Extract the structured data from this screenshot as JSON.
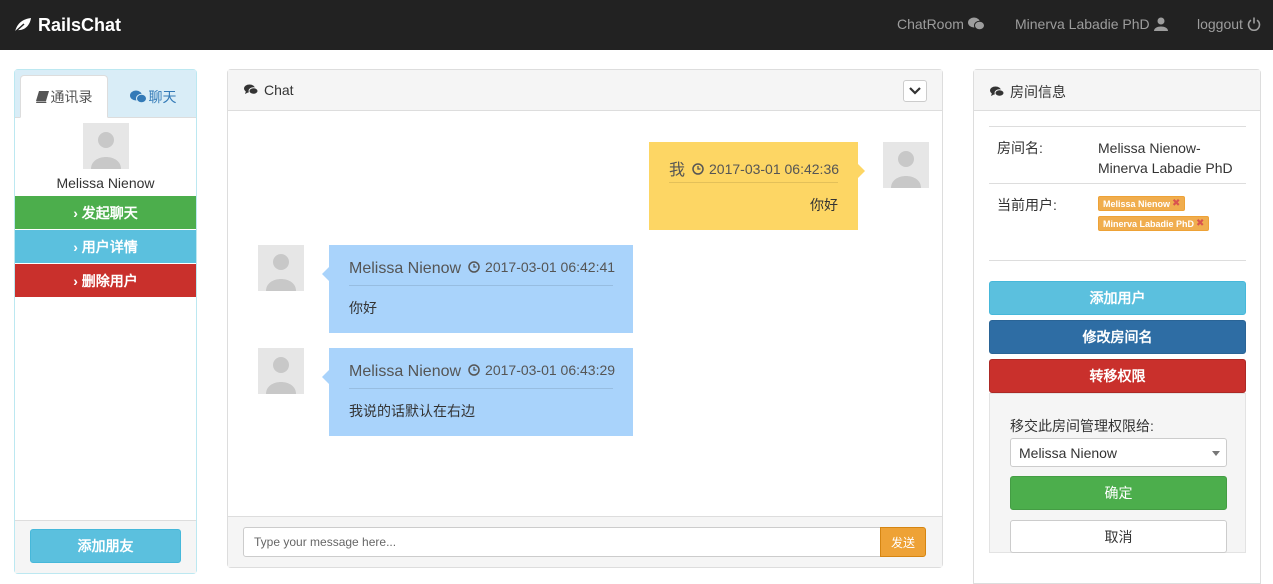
{
  "navbar": {
    "brand": "RailsChat",
    "chatroom": "ChatRoom",
    "user": "Minerva Labadie PhD",
    "logout": "loggout"
  },
  "sidebar": {
    "tabs": [
      {
        "label": "通讯录",
        "icon": "book-icon"
      },
      {
        "label": "聊天",
        "icon": "wechat-icon"
      }
    ],
    "contact_name": "Melissa Nienow",
    "actions": [
      {
        "label": "› 发起聊天",
        "color": "#4cae4c"
      },
      {
        "label": "› 用户详情",
        "color": "#5bc0de"
      },
      {
        "label": "› 删除用户",
        "color": "#c9302c"
      }
    ],
    "add_friend": "添加朋友"
  },
  "chat": {
    "title": "Chat",
    "messages": [
      {
        "sender": "我",
        "time": "2017-03-01 06:42:36",
        "text": "你好",
        "mine": true
      },
      {
        "sender": "Melissa Nienow",
        "time": "2017-03-01 06:42:41",
        "text": "你好",
        "mine": false
      },
      {
        "sender": "Melissa Nienow",
        "time": "2017-03-01 06:43:29",
        "text": "我说的话默认在右边",
        "mine": false
      }
    ],
    "input_placeholder": "Type your message here...",
    "send": "发送"
  },
  "room": {
    "title": "房间信息",
    "name_key": "房间名:",
    "name_value": "Melissa Nienow-Minerva Labadie PhD",
    "users_key": "当前用户:",
    "users": [
      "Melissa Nienow",
      "Minerva Labadie PhD"
    ],
    "add_user": "添加用户",
    "rename": "修改房间名",
    "transfer": "转移权限",
    "transfer_label": "移交此房间管理权限给:",
    "transfer_selected": "Melissa Nienow",
    "confirm": "确定",
    "cancel": "取消"
  },
  "colors": {
    "mine_bubble": "#fdd664",
    "other_bubble": "#a9d3fb",
    "navbar": "#222222"
  }
}
